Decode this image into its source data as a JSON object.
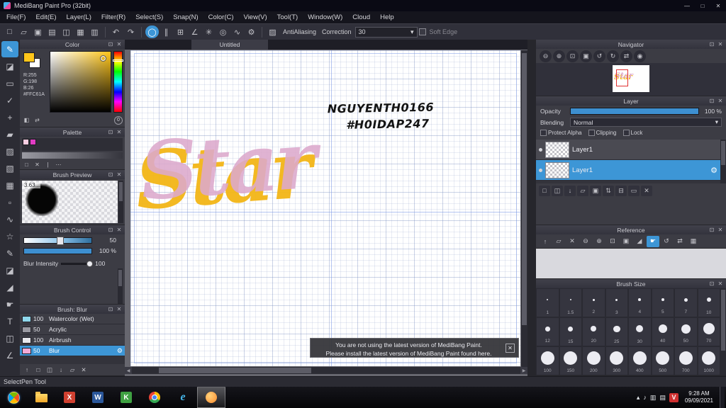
{
  "glyphs": {
    "popout": "⊡",
    "close": "✕",
    "minimize": "—",
    "maximize": "□",
    "dropdown": "▾",
    "gear": "⚙",
    "antialias": "▨",
    "scroll_left": "◀",
    "scroll_right": "▶",
    "tray_arrow": "▴",
    "volume": "♪",
    "network": "▥",
    "keyboard": "▤"
  },
  "window": {
    "title": "MediBang Paint Pro (32bit)"
  },
  "menubar": {
    "items": [
      "File(F)",
      "Edit(E)",
      "Layer(L)",
      "Filter(R)",
      "Select(S)",
      "Snap(N)",
      "Color(C)",
      "View(V)",
      "Tool(T)",
      "Window(W)",
      "Cloud",
      "Help"
    ]
  },
  "toolbar": {
    "file_icons": [
      {
        "name": "new-canvas-icon",
        "glyph": "□"
      },
      {
        "name": "open-icon",
        "glyph": "▱"
      },
      {
        "name": "save-icon",
        "glyph": "▣"
      },
      {
        "name": "export-icon",
        "glyph": "▤"
      },
      {
        "name": "copy-icon",
        "glyph": "◫"
      },
      {
        "name": "grid-view-icon",
        "glyph": "▦"
      },
      {
        "name": "materials-icon",
        "glyph": "▥"
      }
    ],
    "undo_icon": "↶",
    "redo_icon": "↷",
    "snap_icons": [
      {
        "name": "snap-off-icon",
        "glyph": "◯",
        "sel": true
      },
      {
        "name": "snap-parallel-icon",
        "glyph": "∥"
      },
      {
        "name": "snap-cross-icon",
        "glyph": "⊞"
      },
      {
        "name": "snap-vanishing-icon",
        "glyph": "∠"
      },
      {
        "name": "snap-radial-icon",
        "glyph": "✳"
      },
      {
        "name": "snap-circle-icon",
        "glyph": "◎"
      },
      {
        "name": "snap-curve-icon",
        "glyph": "∿"
      },
      {
        "name": "snap-settings-icon",
        "glyph": "⚙"
      }
    ],
    "antialiasing_label": "AntiAliasing",
    "correction_label": "Correction",
    "correction_value": "30",
    "soft_edge_label": "Soft Edge"
  },
  "tools": {
    "items": [
      {
        "name": "pen-tool",
        "glyph": "✎",
        "sel": true
      },
      {
        "name": "eraser-tool",
        "glyph": "◪"
      },
      {
        "name": "rect-select-tool",
        "glyph": "▭"
      },
      {
        "name": "auto-select-tool",
        "glyph": "✓"
      },
      {
        "name": "move-tool",
        "glyph": "+"
      },
      {
        "name": "fill-tool",
        "glyph": "▰"
      },
      {
        "name": "bucket-tool",
        "glyph": "▨"
      },
      {
        "name": "gradient-tool",
        "glyph": "▧"
      },
      {
        "name": "tile-tool",
        "glyph": "▦"
      },
      {
        "name": "dot-tool",
        "glyph": "▫"
      },
      {
        "name": "lasso-tool",
        "glyph": "∿"
      },
      {
        "name": "magic-wand-tool",
        "glyph": "☆"
      },
      {
        "name": "select-pen-tool",
        "glyph": "✎"
      },
      {
        "name": "select-eraser-tool",
        "glyph": "◪"
      },
      {
        "name": "eyedropper-tool",
        "glyph": "◢"
      },
      {
        "name": "hand-tool",
        "glyph": "☛"
      },
      {
        "name": "text-tool",
        "glyph": "T"
      },
      {
        "name": "divide-tool",
        "glyph": "◫"
      },
      {
        "name": "measure-tool",
        "glyph": "∠"
      }
    ]
  },
  "color_panel": {
    "title": "Color",
    "r": "R:255",
    "g": "G:198",
    "b": "B:26",
    "hex": "#FFC61A",
    "fg": "#FFC61A",
    "bg": "#FFFFFF",
    "footer_icons": [
      {
        "name": "color-set-icon",
        "glyph": "◧"
      },
      {
        "name": "color-swap-icon",
        "glyph": "⇄"
      }
    ],
    "transparent_label": "0"
  },
  "palette_panel": {
    "title": "Palette",
    "swatches": [
      "#F7CDE0",
      "#E23CC4"
    ],
    "footer_icons": [
      {
        "name": "palette-add-icon",
        "glyph": "□"
      },
      {
        "name": "palette-delete-icon",
        "glyph": "✕"
      },
      {
        "name": "palette-divider-icon",
        "glyph": "|"
      },
      {
        "name": "palette-menu-icon",
        "glyph": "⋯"
      }
    ]
  },
  "brush_preview_panel": {
    "title": "Brush Preview",
    "size_label": "3.63..."
  },
  "brush_control_panel": {
    "title": "Brush Control",
    "size_value": "50",
    "opacity_value": "100 %",
    "blur_label": "Blur Intensity",
    "blur_value": "100"
  },
  "brush_list_panel": {
    "title": "Brush: Blur",
    "items": [
      {
        "size": "100",
        "name": "Watercolor (Wet)",
        "color": "#8FD8EC",
        "sel": false
      },
      {
        "size": "50",
        "name": "Acrylic",
        "color": "#9A9AA2",
        "sel": false
      },
      {
        "size": "100",
        "name": "Airbrush",
        "color": "#E8E8EC",
        "sel": false
      },
      {
        "size": "50",
        "name": "Blur",
        "color": "#F2AAD6",
        "sel": true
      }
    ],
    "footer_icons": [
      {
        "name": "brush-up-icon",
        "glyph": "↑"
      },
      {
        "name": "brush-add-icon",
        "glyph": "□"
      },
      {
        "name": "brush-duplicate-icon",
        "glyph": "◫"
      },
      {
        "name": "brush-down-icon",
        "glyph": "↓"
      },
      {
        "name": "brush-folder-icon",
        "glyph": "▱"
      },
      {
        "name": "brush-delete-icon",
        "glyph": "✕"
      }
    ]
  },
  "canvas": {
    "tab": "Untitled",
    "overlay_line1": "NGUYENTH0166",
    "overlay_line2": "#H0IDAP247",
    "artwork_word": "Star",
    "notification_line1": "You are not using the latest version of MediBang Paint.",
    "notification_line2": "Please install the latest version of MediBang Paint found here."
  },
  "navigator": {
    "title": "Navigator",
    "icons": [
      {
        "name": "nav-zoom-out-icon",
        "glyph": "⊖"
      },
      {
        "name": "nav-zoom-in-icon",
        "glyph": "⊕"
      },
      {
        "name": "nav-fit-icon",
        "glyph": "⊡"
      },
      {
        "name": "nav-actual-size-icon",
        "glyph": "▣"
      },
      {
        "name": "nav-rotate-left-icon",
        "glyph": "↺"
      },
      {
        "name": "nav-rotate-right-icon",
        "glyph": "↻"
      },
      {
        "name": "nav-flip-icon",
        "glyph": "⇄"
      },
      {
        "name": "nav-reset-icon",
        "glyph": "◉"
      }
    ]
  },
  "layer_panel": {
    "title": "Layer",
    "opacity_label": "Opacity",
    "opacity_value": "100 %",
    "blending_label": "Blending",
    "blending_value": "Normal",
    "protect_alpha_label": "Protect Alpha",
    "clipping_label": "Clipping",
    "lock_label": "Lock",
    "layers": [
      {
        "name": "Layer1",
        "sel": false
      },
      {
        "name": "Layer1",
        "sel": true
      }
    ],
    "footer_icons": [
      {
        "name": "layer-add-icon",
        "glyph": "□"
      },
      {
        "name": "layer-duplicate-icon",
        "glyph": "◫"
      },
      {
        "name": "layer-transfer-icon",
        "glyph": "↓"
      },
      {
        "name": "layer-folder-icon",
        "glyph": "▱"
      },
      {
        "name": "layer-mask-icon",
        "glyph": "▣"
      },
      {
        "name": "layer-order-icon",
        "glyph": "⇅"
      },
      {
        "name": "layer-merge-icon",
        "glyph": "⊟"
      },
      {
        "name": "layer-clear-icon",
        "glyph": "▭"
      },
      {
        "name": "layer-delete-icon",
        "glyph": "✕"
      }
    ]
  },
  "reference_panel": {
    "title": "Reference",
    "icons": [
      {
        "name": "ref-up-icon",
        "glyph": "↑"
      },
      {
        "name": "ref-open-icon",
        "glyph": "▱"
      },
      {
        "name": "ref-close-icon",
        "glyph": "✕"
      },
      {
        "name": "ref-zoom-out-icon",
        "glyph": "⊖"
      },
      {
        "name": "ref-zoom-in-icon",
        "glyph": "⊕"
      },
      {
        "name": "ref-fit-icon",
        "glyph": "⊡"
      },
      {
        "name": "ref-actual-size-icon",
        "glyph": "▣"
      },
      {
        "name": "ref-eyedropper-icon",
        "glyph": "◢"
      },
      {
        "name": "ref-hand-icon",
        "glyph": "☛",
        "sel": true
      },
      {
        "name": "ref-rotate-icon",
        "glyph": "↺"
      },
      {
        "name": "ref-flip-icon",
        "glyph": "⇄"
      },
      {
        "name": "ref-image-icon",
        "glyph": "▦"
      }
    ]
  },
  "brush_size_panel": {
    "title": "Brush Size",
    "sizes": [
      "1",
      "1.5",
      "2",
      "3",
      "4",
      "5",
      "7",
      "10",
      "12",
      "15",
      "20",
      "25",
      "30",
      "40",
      "50",
      "70",
      "100",
      "150",
      "200",
      "300",
      "400",
      "500",
      "700",
      "1000"
    ]
  },
  "statusbar": {
    "text": "SelectPen Tool"
  },
  "taskbar": {
    "apps": [
      {
        "name": "file-explorer-icon",
        "kind": "folder"
      },
      {
        "name": "app-red-icon",
        "kind": "letter",
        "letter": "X",
        "color": "#D04030"
      },
      {
        "name": "word-icon",
        "kind": "letter",
        "letter": "W",
        "color": "#2B579A"
      },
      {
        "name": "app-green-icon",
        "kind": "letter",
        "letter": "K",
        "color": "#3FA142"
      },
      {
        "name": "chrome-icon",
        "kind": "chrome"
      },
      {
        "name": "ie-icon",
        "kind": "letter-plain",
        "letter": "e",
        "color": "#45B6EA"
      },
      {
        "name": "medibang-icon",
        "kind": "orb",
        "color": "#FF8C2E",
        "active": true
      }
    ],
    "unikey_letter": "V",
    "time": "9:28 AM",
    "date": "09/09/2021"
  }
}
